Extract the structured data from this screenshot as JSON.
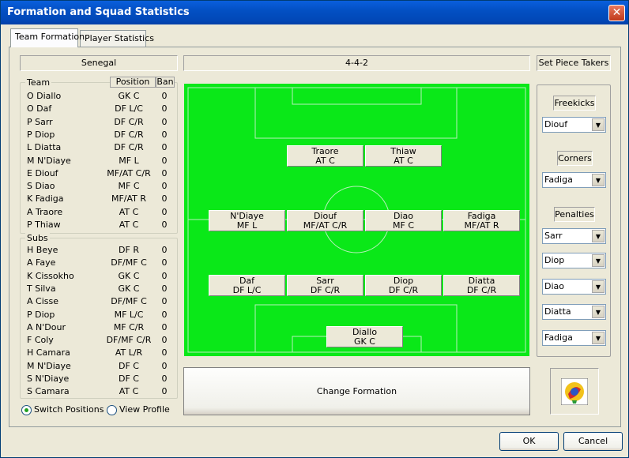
{
  "window": {
    "title": "Formation and Squad Statistics",
    "close_glyph": "✕"
  },
  "tabs": {
    "formation": "Team Formation",
    "stats": "Player Statistics"
  },
  "team_name": "Senegal",
  "formation": "4-4-2",
  "set_piece_header": "Set Piece Takers",
  "team_table": {
    "legend": "Team",
    "col_position": "Position",
    "col_ban": "Ban",
    "rows": [
      {
        "name": "O Diallo",
        "pos": "GK C",
        "ban": "0"
      },
      {
        "name": "O Daf",
        "pos": "DF L/C",
        "ban": "0"
      },
      {
        "name": "P Sarr",
        "pos": "DF C/R",
        "ban": "0"
      },
      {
        "name": "P Diop",
        "pos": "DF C/R",
        "ban": "0"
      },
      {
        "name": "L Diatta",
        "pos": "DF C/R",
        "ban": "0"
      },
      {
        "name": "M N'Diaye",
        "pos": "MF L",
        "ban": "0"
      },
      {
        "name": "E Diouf",
        "pos": "MF/AT C/R",
        "ban": "0"
      },
      {
        "name": "S Diao",
        "pos": "MF C",
        "ban": "0"
      },
      {
        "name": "K Fadiga",
        "pos": "MF/AT R",
        "ban": "0"
      },
      {
        "name": "A Traore",
        "pos": "AT C",
        "ban": "0"
      },
      {
        "name": "P Thiaw",
        "pos": "AT C",
        "ban": "0"
      }
    ]
  },
  "subs_table": {
    "legend": "Subs",
    "rows": [
      {
        "name": "H Beye",
        "pos": "DF R",
        "ban": "0"
      },
      {
        "name": "A Faye",
        "pos": "DF/MF C",
        "ban": "0"
      },
      {
        "name": "K Cissokho",
        "pos": "GK C",
        "ban": "0"
      },
      {
        "name": "T Silva",
        "pos": "GK C",
        "ban": "0"
      },
      {
        "name": "A Cisse",
        "pos": "DF/MF C",
        "ban": "0"
      },
      {
        "name": "P Diop",
        "pos": "MF L/C",
        "ban": "0"
      },
      {
        "name": "A N'Dour",
        "pos": "MF C/R",
        "ban": "0"
      },
      {
        "name": "F Coly",
        "pos": "DF/MF C/R",
        "ban": "0"
      },
      {
        "name": "H Camara",
        "pos": "AT L/R",
        "ban": "0"
      },
      {
        "name": "M N'Diaye",
        "pos": "DF C",
        "ban": "0"
      },
      {
        "name": "S N'Diaye",
        "pos": "DF C",
        "ban": "0"
      },
      {
        "name": "S Camara",
        "pos": "AT C",
        "ban": "0"
      }
    ]
  },
  "mode": {
    "switch": "Switch Positions",
    "view": "View Profile",
    "selected": "switch"
  },
  "pitch": {
    "attack": [
      {
        "name": "Traore",
        "pos": "AT C"
      },
      {
        "name": "Thiaw",
        "pos": "AT C"
      }
    ],
    "midfield": [
      {
        "name": "N'Diaye",
        "pos": "MF L"
      },
      {
        "name": "Diouf",
        "pos": "MF/AT C/R"
      },
      {
        "name": "Diao",
        "pos": "MF C"
      },
      {
        "name": "Fadiga",
        "pos": "MF/AT R"
      }
    ],
    "defence": [
      {
        "name": "Daf",
        "pos": "DF L/C"
      },
      {
        "name": "Sarr",
        "pos": "DF C/R"
      },
      {
        "name": "Diop",
        "pos": "DF C/R"
      },
      {
        "name": "Diatta",
        "pos": "DF C/R"
      }
    ],
    "keeper": {
      "name": "Diallo",
      "pos": "GK C"
    }
  },
  "change_formation": "Change Formation",
  "set_pieces": {
    "freekicks_label": "Freekicks",
    "freekicks": "Diouf",
    "corners_label": "Corners",
    "corners": "Fadiga",
    "penalties_label": "Penalties",
    "penalties": [
      "Sarr",
      "Diop",
      "Diao",
      "Diatta",
      "Fadiga"
    ]
  },
  "buttons": {
    "ok": "OK",
    "cancel": "Cancel"
  },
  "icons": {
    "dropdown": "▼"
  }
}
